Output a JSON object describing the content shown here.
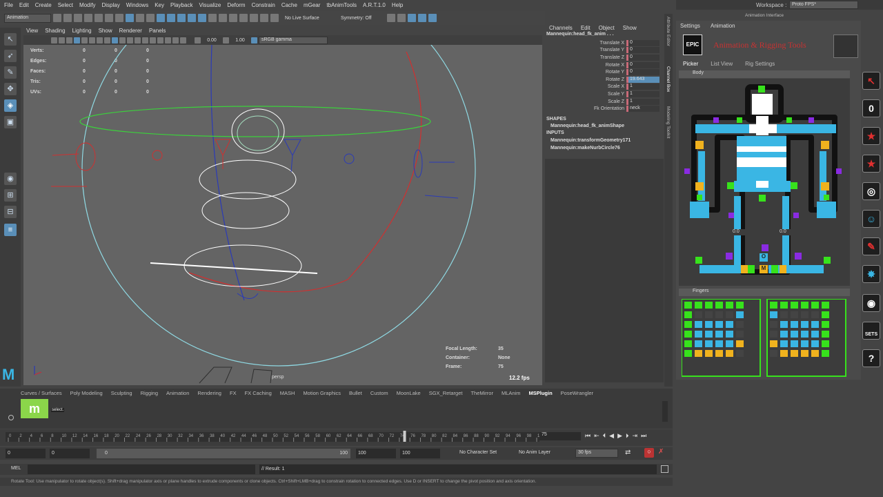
{
  "menubar": {
    "items": [
      "File",
      "Edit",
      "Create",
      "Select",
      "Modify",
      "Display",
      "Windows",
      "Key",
      "Playback",
      "Visualize",
      "Deform",
      "Constrain",
      "Cache",
      "mGear",
      "tbAnimTools",
      "A.R.T.1.0",
      "Help"
    ]
  },
  "workspace": {
    "label": "Workspace :",
    "value": "Proto FPS*"
  },
  "statusline": {
    "mode": "Animation",
    "live_surface": "No Live Surface",
    "symmetry": "Symmetry: Off"
  },
  "viewport": {
    "menu": [
      "View",
      "Shading",
      "Lighting",
      "Show",
      "Renderer",
      "Panels"
    ],
    "exposure": "0.00",
    "gamma": "1.00",
    "colorspace": "sRGB gamma",
    "hud": [
      {
        "label": "Verts:",
        "v1": "0",
        "v2": "0",
        "v3": "0"
      },
      {
        "label": "Edges:",
        "v1": "0",
        "v2": "0",
        "v3": "0"
      },
      {
        "label": "Faces:",
        "v1": "0",
        "v2": "0",
        "v3": "0"
      },
      {
        "label": "Tris:",
        "v1": "0",
        "v2": "0",
        "v3": "0"
      },
      {
        "label": "UVs:",
        "v1": "0",
        "v2": "0",
        "v3": "0"
      }
    ],
    "focal_label": "Focal Length:",
    "focal_value": "35",
    "container_label": "Container:",
    "container_value": "None",
    "frame_label": "Frame:",
    "frame_value": "75",
    "fps": "12.2 fps",
    "camera": "persp"
  },
  "channel": {
    "menu": [
      "Channels",
      "Edit",
      "Object",
      "Show"
    ],
    "node": "Mannequin:head_fk_anim . . .",
    "attrs": [
      {
        "label": "Translate X",
        "value": "0"
      },
      {
        "label": "Translate Y",
        "value": "0"
      },
      {
        "label": "Translate Z",
        "value": "0"
      },
      {
        "label": "Rotate X",
        "value": "0"
      },
      {
        "label": "Rotate Y",
        "value": "0"
      },
      {
        "label": "Rotate Z",
        "value": "19.643"
      },
      {
        "label": "Scale X",
        "value": "1"
      },
      {
        "label": "Scale Y",
        "value": "1"
      },
      {
        "label": "Scale Z",
        "value": "1"
      },
      {
        "label": "Fk Orientation",
        "value": "neck"
      }
    ],
    "shapes_header": "SHAPES",
    "shape": "Mannequin:head_fk_animShape",
    "inputs_header": "INPUTS",
    "inputs": [
      "Mannequin:transformGeometry171",
      "Mannequin:makeNurbCircle76"
    ],
    "side_tabs": [
      "Attribute Editor",
      "Channel Box",
      "Modeling Toolkit"
    ]
  },
  "art": {
    "tabs": [
      "Settings",
      "Animation"
    ],
    "title": "Animation Interface",
    "logo": "EPIC",
    "banner": "Animation & Rigging Tools",
    "subtabs": [
      "Picker",
      "List View",
      "Rig Settings"
    ],
    "body_section": "Body",
    "fingers_section": "Fingers",
    "left_value": "0.0",
    "right_value": "0.0",
    "m_button": "M",
    "o_button": "O",
    "side_tools": [
      "0",
      "SETS",
      "?"
    ]
  },
  "shelf": {
    "tabs": [
      "Curves / Surfaces",
      "Poly Modeling",
      "Sculpting",
      "Rigging",
      "Animation",
      "Rendering",
      "FX",
      "FX Caching",
      "MASH",
      "Motion Graphics",
      "Bullet",
      "Custom",
      "MoonLake",
      "SGX_Retarget",
      "TheMirror",
      "MLAnim",
      "MSPlugin",
      "PoseWrangler"
    ],
    "active": "MSPlugin",
    "item_tooltip": "select."
  },
  "timeline": {
    "ticks": [
      "0",
      "2",
      "4",
      "6",
      "8",
      "10",
      "12",
      "14",
      "16",
      "18",
      "20",
      "22",
      "24",
      "26",
      "28",
      "30",
      "32",
      "34",
      "36",
      "38",
      "40",
      "42",
      "44",
      "46",
      "48",
      "50",
      "52",
      "54",
      "56",
      "58",
      "60",
      "62",
      "64",
      "66",
      "68",
      "70",
      "72",
      "74",
      "76",
      "78",
      "80",
      "82",
      "84",
      "86",
      "88",
      "90",
      "92",
      "94",
      "96",
      "98",
      "100"
    ],
    "current_frame": "75"
  },
  "range": {
    "start": "0",
    "anim_start": "0",
    "slider_start": "0",
    "slider_end": "100",
    "anim_end": "100",
    "end": "100",
    "char_set": "No Character Set",
    "anim_layer": "No Anim Layer",
    "fps": "30 fps"
  },
  "mel": {
    "label": "MEL",
    "result": "// Result: 1"
  },
  "help": {
    "text": "Rotate Tool: Use manipulator to rotate object(s). Shift+drag manipulator axis or plane handles to extrude components or clone objects. Ctrl+Shift+LMB+drag to constrain rotation to connected edges. Use D or INSERT to change the pivot position and axis orientation."
  },
  "colors": {
    "accent": "#5a8fb8",
    "picker_cyan": "#3ab6e4",
    "finger_green": "#37e21c",
    "finger_yellow": "#f0b21e",
    "control_purple": "#8a2be2"
  }
}
